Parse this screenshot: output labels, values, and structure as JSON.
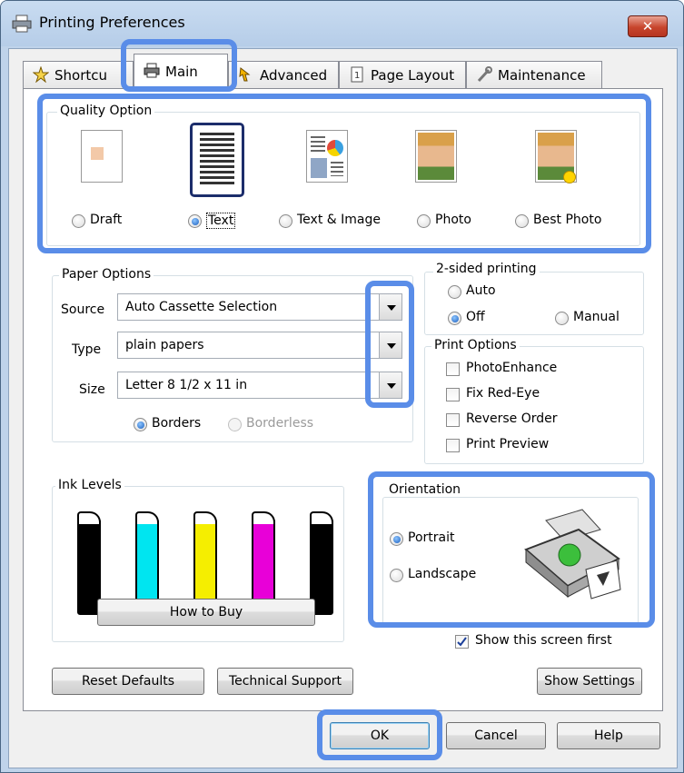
{
  "window": {
    "title": "Printing Preferences",
    "close_symbol": "✕"
  },
  "tabs": [
    {
      "label": "Shortcu",
      "icon": "star-icon"
    },
    {
      "label": "Main",
      "icon": "printer-icon",
      "active": true
    },
    {
      "label": "Advanced",
      "icon": "advanced-icon"
    },
    {
      "label": "Page Layout",
      "icon": "page-layout-icon"
    },
    {
      "label": "Maintenance",
      "icon": "wrench-icon"
    }
  ],
  "quality": {
    "label": "Quality Option",
    "options": [
      {
        "label": "Draft",
        "selected": false
      },
      {
        "label": "Text",
        "selected": true
      },
      {
        "label": "Text & Image",
        "selected": false
      },
      {
        "label": "Photo",
        "selected": false
      },
      {
        "label": "Best Photo",
        "selected": false
      }
    ]
  },
  "paper": {
    "label": "Paper Options",
    "source_label": "Source",
    "source_value": "Auto Cassette Selection",
    "type_label": "Type",
    "type_value": "plain papers",
    "size_label": "Size",
    "size_value": "Letter 8 1/2 x 11 in",
    "borders_label": "Borders",
    "borderless_label": "Borderless"
  },
  "two_sided": {
    "label": "2-sided printing",
    "auto": "Auto",
    "off": "Off",
    "manual": "Manual",
    "selected": "Off"
  },
  "print_options": {
    "label": "Print Options",
    "items": [
      {
        "label": "PhotoEnhance",
        "checked": false
      },
      {
        "label": "Fix Red-Eye",
        "checked": false
      },
      {
        "label": "Reverse Order",
        "checked": false
      },
      {
        "label": "Print Preview",
        "checked": false
      }
    ]
  },
  "ink": {
    "label": "Ink Levels",
    "colors": [
      "#000000",
      "#00e5f0",
      "#f5ee00",
      "#e800d8",
      "#000000"
    ],
    "how_to_buy": "How to Buy"
  },
  "orientation": {
    "label": "Orientation",
    "portrait": "Portrait",
    "landscape": "Landscape",
    "selected": "Portrait"
  },
  "show_first": {
    "label": "Show this screen first",
    "checked": true
  },
  "buttons": {
    "reset": "Reset Defaults",
    "support": "Technical Support",
    "show_settings": "Show Settings",
    "ok": "OK",
    "cancel": "Cancel",
    "help": "Help"
  },
  "colors": {
    "highlight": "#5a8de8",
    "radio_selected": "#1a5fbf"
  }
}
